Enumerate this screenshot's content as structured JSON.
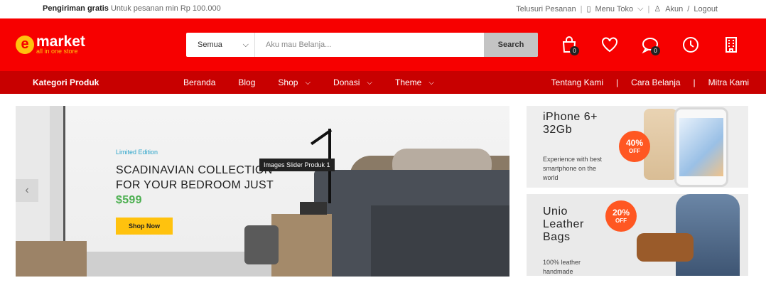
{
  "topbar": {
    "shipping_bold": "Pengiriman gratis",
    "shipping_text": "Untuk pesanan min Rp 100.000",
    "track": "Telusuri Pesanan",
    "store_menu": "Menu Toko",
    "account": "Akun",
    "divider": "/",
    "logout": "Logout"
  },
  "header": {
    "brand": "market",
    "brand_initial": "e",
    "tagline": "all in one store",
    "search": {
      "category": "Semua",
      "placeholder": "Aku mau Belanja...",
      "button": "Search"
    },
    "icons": [
      {
        "name": "cart-icon",
        "badge": "0"
      },
      {
        "name": "heart-icon",
        "badge": ""
      },
      {
        "name": "chat-icon",
        "badge": "0"
      },
      {
        "name": "history-icon",
        "badge": ""
      },
      {
        "name": "building-icon",
        "badge": ""
      }
    ]
  },
  "nav": {
    "categories": "Kategori Produk",
    "menu": [
      "Beranda",
      "Blog",
      "Shop",
      "Donasi",
      "Theme"
    ],
    "right": [
      "Tentang Kami",
      "Cara Belanja",
      "Mitra Kami"
    ]
  },
  "hero": {
    "tag": "Limited Edition",
    "headline": "SCADINAVIAN COLLECTION FOR YOUR BEDROOM JUST",
    "price": "$599",
    "button": "Shop Now",
    "tooltip": "Images Slider Produk 1",
    "prev_arrow": "‹"
  },
  "promos": [
    {
      "title": "iPhone 6+ 32Gb",
      "desc": "Experience with best smartphone on the world",
      "discount": "40%",
      "off": "OFF"
    },
    {
      "title": "Unio Leather Bags",
      "desc": "100% leather handmade",
      "discount": "20%",
      "off": "OFF"
    }
  ],
  "colors": {
    "primary": "#f70000",
    "nav": "#c80000",
    "accent": "#ffc20e",
    "discount": "#ff5722"
  }
}
